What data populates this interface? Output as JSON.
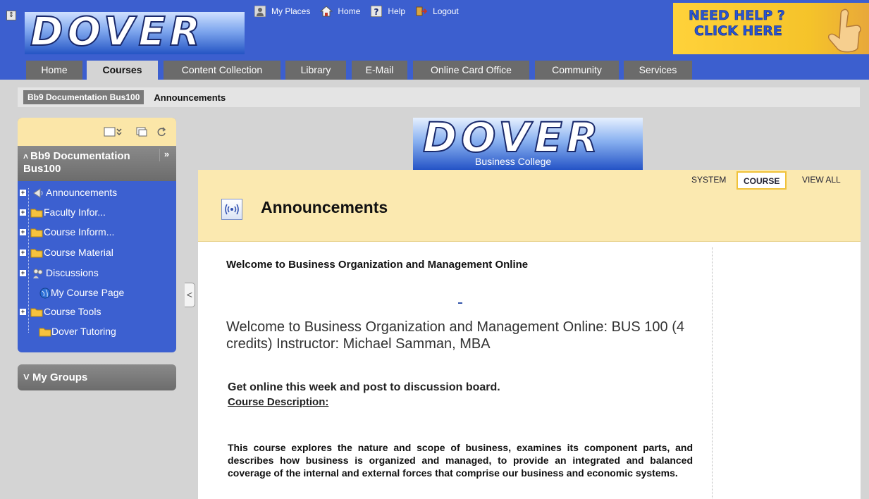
{
  "header": {
    "logo_text": "DOVER",
    "top_links": [
      {
        "label": "My Places",
        "icon": "person-icon"
      },
      {
        "label": "Home",
        "icon": "house-icon"
      },
      {
        "label": "Help",
        "icon": "help-icon"
      },
      {
        "label": "Logout",
        "icon": "logout-icon"
      }
    ],
    "need_help_line1": "NEED HELP ?",
    "need_help_line2": "CLICK HERE"
  },
  "tabs": [
    {
      "label": "Home"
    },
    {
      "label": "Courses",
      "active": true
    },
    {
      "label": "Content Collection"
    },
    {
      "label": "Library"
    },
    {
      "label": "E-Mail"
    },
    {
      "label": "Online Card Office"
    },
    {
      "label": "Community"
    },
    {
      "label": "Services"
    }
  ],
  "breadcrumb": {
    "course": "Bb9 Documentation Bus100",
    "current": "Announcements"
  },
  "course_menu": {
    "title": "Bb9 Documentation Bus100",
    "items": [
      {
        "label": "Announcements",
        "icon": "announcement-icon"
      },
      {
        "label": "Faculty Infor...",
        "icon": "folder-icon"
      },
      {
        "label": "Course Inform...",
        "icon": "folder-icon"
      },
      {
        "label": "Course Material",
        "icon": "folder-icon"
      },
      {
        "label": "Discussions",
        "icon": "discussion-icon"
      },
      {
        "label": "My Course Page",
        "icon": "globe-icon"
      },
      {
        "label": "Course Tools",
        "icon": "folder-icon"
      },
      {
        "label": "Dover Tutoring",
        "icon": "folder-icon"
      }
    ]
  },
  "groups": {
    "label": "My Groups"
  },
  "banner": {
    "logo_text": "DOVER",
    "subtitle": "Business College"
  },
  "content": {
    "page_title": "Announcements",
    "view_buttons": [
      {
        "label": "SYSTEM"
      },
      {
        "label": "COURSE",
        "active": true
      },
      {
        "label": "VIEW ALL"
      }
    ],
    "announcement": {
      "title": "Welcome to Business Organization and Management Online",
      "welcome": "Welcome to Business Organization and Management Online: BUS 100 (4 credits)  Instructor: Michael Samman, MBA",
      "get_online": "Get online this week and post to discussion board.",
      "desc_heading": "Course Description:",
      "description": "This course explores the nature and scope of business, examines its component parts, and describes how business is organized and managed, to provide an integrated and balanced coverage of the internal and external forces that comprise our business and economic systems."
    }
  },
  "colors": {
    "header_blue": "#3c5fcf",
    "tab_gray": "#6b6b6b",
    "menu_blue": "#3c60d0",
    "content_header": "#fbe9b0",
    "help_yellow": "#ffd23a"
  }
}
